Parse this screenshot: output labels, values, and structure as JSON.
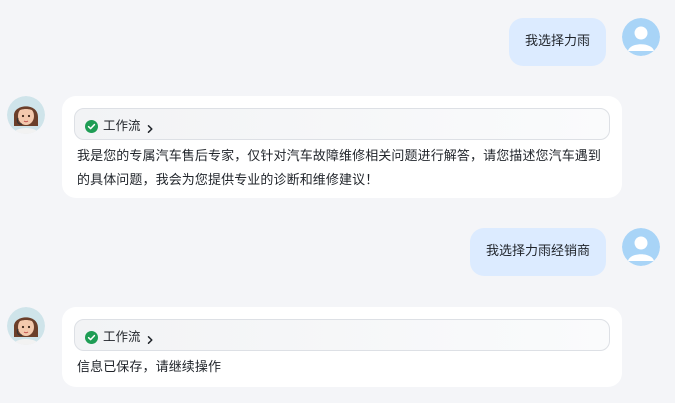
{
  "messages": [
    {
      "role": "user",
      "text": "我选择力雨"
    },
    {
      "role": "assistant",
      "workflow_label": "工作流",
      "text": "我是您的专属汽车售后专家，仅针对汽车故障维修相关问题进行解答，请您描述您汽车遇到的具体问题，我会为您提供专业的诊断和维修建议！"
    },
    {
      "role": "user",
      "text": "我选择力雨经销商"
    },
    {
      "role": "assistant",
      "workflow_label": "工作流",
      "text": "信息已保存，请继续操作"
    }
  ],
  "colors": {
    "page_background": "#f4f5f8",
    "user_bubble": "#dcebff",
    "assistant_card": "#ffffff",
    "workflow_check": "#1f9d55",
    "text": "#1f2329"
  },
  "icons": {
    "user_avatar": "user-avatar-icon",
    "assistant_avatar": "assistant-avatar",
    "workflow_status": "check-circle-icon",
    "workflow_expand": "chevron-right-icon"
  }
}
